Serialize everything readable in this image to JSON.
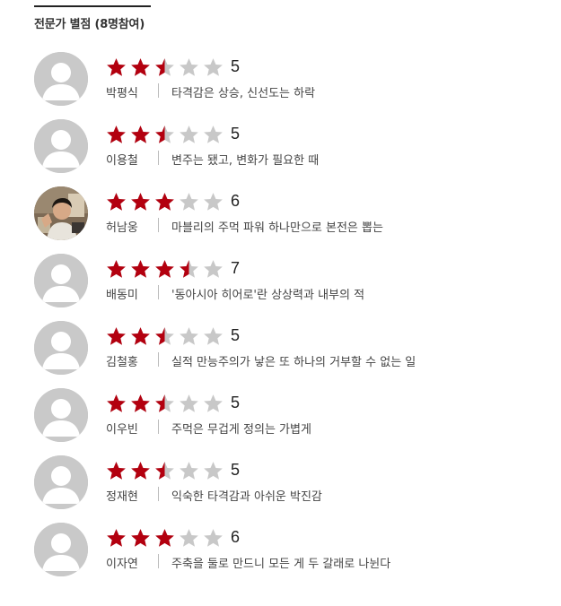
{
  "section": {
    "title": "전문가 별점 (8명참여)"
  },
  "colors": {
    "star_filled": "#b3000f",
    "star_empty": "#c8c8c8",
    "avatar_bg": "#c9c9c9"
  },
  "reviews": [
    {
      "name": "박평식",
      "rating": 5,
      "score": "5",
      "comment": "타격감은 상승, 신선도는 하락",
      "avatar": "default-avatar-icon"
    },
    {
      "name": "이용철",
      "rating": 5,
      "score": "5",
      "comment": "변주는 됐고, 변화가 필요한 때",
      "avatar": "default-avatar-icon"
    },
    {
      "name": "허남웅",
      "rating": 6,
      "score": "6",
      "comment": "마블리의 주먹 파워 하나만으로 본전은 뽑는",
      "avatar": "photo"
    },
    {
      "name": "배동미",
      "rating": 7,
      "score": "7",
      "comment": "'동아시아 히어로'란 상상력과 내부의 적",
      "avatar": "default-avatar-icon"
    },
    {
      "name": "김철홍",
      "rating": 5,
      "score": "5",
      "comment": "실적 만능주의가 낳은 또 하나의 거부할 수 없는 일",
      "avatar": "default-avatar-icon"
    },
    {
      "name": "이우빈",
      "rating": 5,
      "score": "5",
      "comment": "주먹은 무겁게 정의는 가볍게",
      "avatar": "default-avatar-icon"
    },
    {
      "name": "정재현",
      "rating": 5,
      "score": "5",
      "comment": "익숙한 타격감과 아쉬운 박진감",
      "avatar": "default-avatar-icon"
    },
    {
      "name": "이자연",
      "rating": 6,
      "score": "6",
      "comment": "주축을 둘로 만드니 모든 게 두 갈래로 나뉜다",
      "avatar": "default-avatar-icon"
    }
  ]
}
